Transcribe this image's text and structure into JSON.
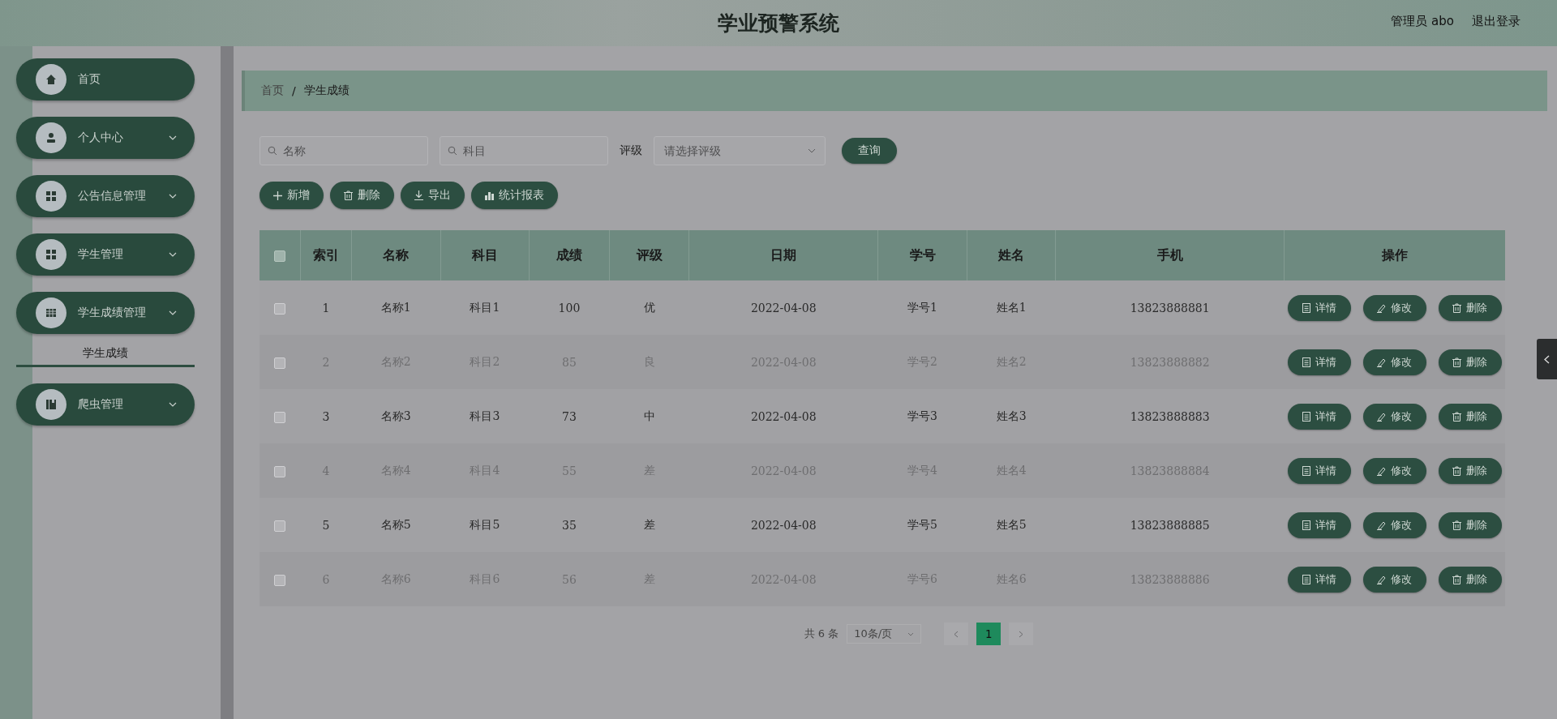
{
  "header": {
    "title": "学业预警系统",
    "user": "管理员 abo",
    "logout": "退出登录"
  },
  "sidebar": {
    "items": [
      {
        "label": "首页",
        "expandable": false
      },
      {
        "label": "个人中心",
        "expandable": true
      },
      {
        "label": "公告信息管理",
        "expandable": true
      },
      {
        "label": "学生管理",
        "expandable": true
      },
      {
        "label": "学生成绩管理",
        "expandable": true,
        "children": [
          {
            "label": "学生成绩",
            "selected": true
          }
        ]
      },
      {
        "label": "爬虫管理",
        "expandable": true
      }
    ]
  },
  "breadcrumb": [
    {
      "kind": "link",
      "label": "首页"
    },
    {
      "kind": "separator",
      "label": "/"
    },
    {
      "kind": "current",
      "label": "学生成绩"
    }
  ],
  "filters": {
    "name": {
      "placeholder": "名称"
    },
    "subject": {
      "placeholder": "科目"
    },
    "grade_label": "评级",
    "grade": {
      "placeholder": "请选择评级"
    },
    "search_button": "查询"
  },
  "actions": [
    {
      "kind": "add",
      "label": "新增"
    },
    {
      "kind": "delete",
      "label": "删除"
    },
    {
      "kind": "export",
      "label": "导出"
    },
    {
      "kind": "chart",
      "label": "统计报表"
    }
  ],
  "table": {
    "select_all_checked": false,
    "columns": [
      "索引",
      "名称",
      "科目",
      "成绩",
      "评级",
      "日期",
      "学号",
      "姓名",
      "手机",
      "操作"
    ],
    "rows": [
      {
        "checked": false,
        "cells": [
          "1",
          "名称1",
          "科目1",
          "100",
          "优",
          "2022-04-08",
          "学号1",
          "姓名1",
          "13823888881"
        ],
        "actions": [
          {
            "kind": "detail",
            "label": "详情"
          },
          {
            "kind": "edit",
            "label": "修改"
          },
          {
            "kind": "delete",
            "label": "删除"
          }
        ]
      },
      {
        "checked": false,
        "cells": [
          "2",
          "名称2",
          "科目2",
          "85",
          "良",
          "2022-04-08",
          "学号2",
          "姓名2",
          "13823888882"
        ],
        "actions": [
          {
            "kind": "detail",
            "label": "详情"
          },
          {
            "kind": "edit",
            "label": "修改"
          },
          {
            "kind": "delete",
            "label": "删除"
          }
        ]
      },
      {
        "checked": false,
        "cells": [
          "3",
          "名称3",
          "科目3",
          "73",
          "中",
          "2022-04-08",
          "学号3",
          "姓名3",
          "13823888883"
        ],
        "actions": [
          {
            "kind": "detail",
            "label": "详情"
          },
          {
            "kind": "edit",
            "label": "修改"
          },
          {
            "kind": "delete",
            "label": "删除"
          }
        ]
      },
      {
        "checked": false,
        "cells": [
          "4",
          "名称4",
          "科目4",
          "55",
          "差",
          "2022-04-08",
          "学号4",
          "姓名4",
          "13823888884"
        ],
        "actions": [
          {
            "kind": "detail",
            "label": "详情"
          },
          {
            "kind": "edit",
            "label": "修改"
          },
          {
            "kind": "delete",
            "label": "删除"
          }
        ]
      },
      {
        "checked": false,
        "cells": [
          "5",
          "名称5",
          "科目5",
          "35",
          "差",
          "2022-04-08",
          "学号5",
          "姓名5",
          "13823888885"
        ],
        "actions": [
          {
            "kind": "detail",
            "label": "详情"
          },
          {
            "kind": "edit",
            "label": "修改"
          },
          {
            "kind": "delete",
            "label": "删除"
          }
        ]
      },
      {
        "checked": false,
        "cells": [
          "6",
          "名称6",
          "科目6",
          "56",
          "差",
          "2022-04-08",
          "学号6",
          "姓名6",
          "13823888886"
        ],
        "actions": [
          {
            "kind": "detail",
            "label": "详情"
          },
          {
            "kind": "edit",
            "label": "修改"
          },
          {
            "kind": "delete",
            "label": "删除"
          }
        ]
      }
    ]
  },
  "pagination": {
    "total": "共 6 条",
    "page_size": "10条/页",
    "pages": [
      {
        "label": "1",
        "selected": true
      }
    ]
  }
}
